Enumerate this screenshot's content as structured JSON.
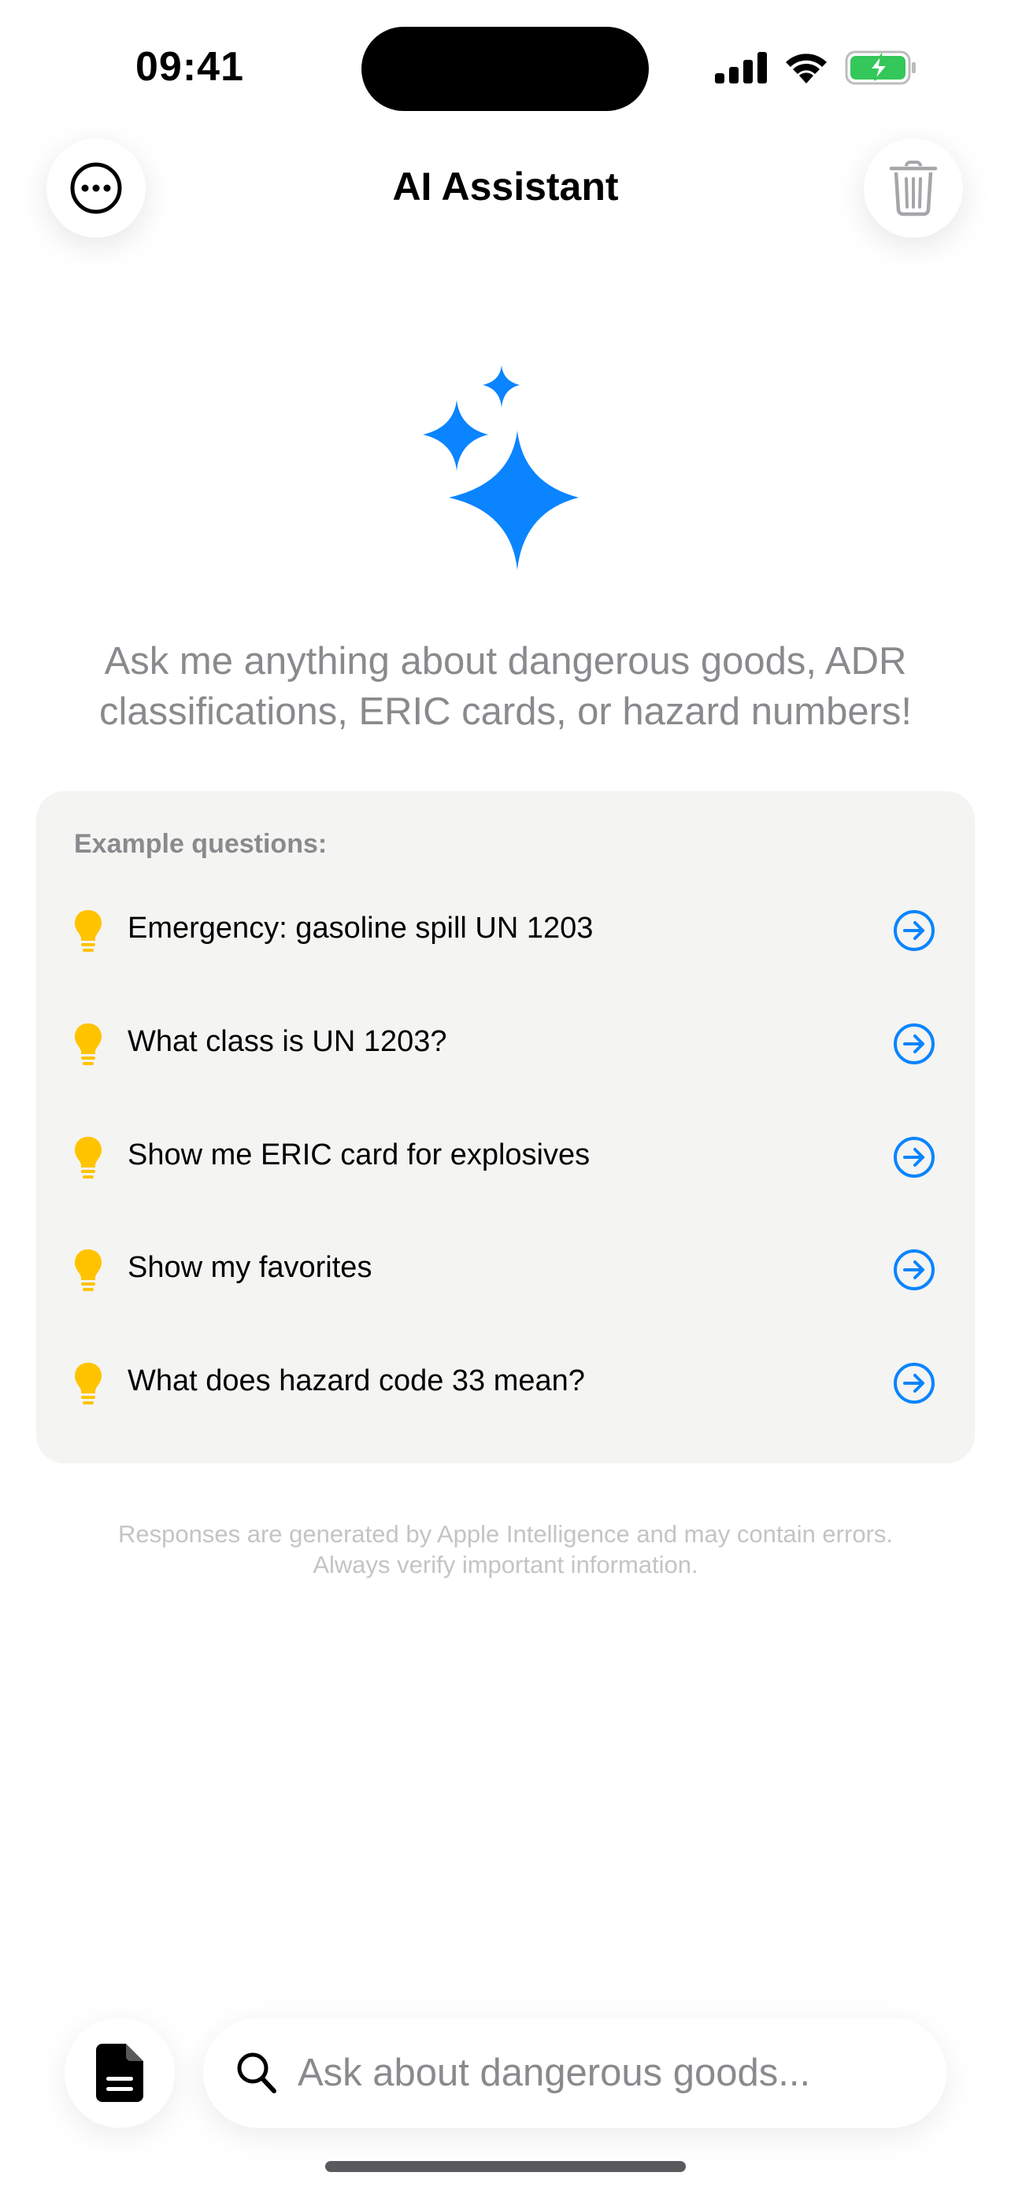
{
  "status_bar": {
    "time": "09:41"
  },
  "nav": {
    "title": "AI Assistant",
    "left_icon": "ellipsis-circle-icon",
    "right_icon": "trash-icon"
  },
  "hero": {
    "icon": "sparkles-icon",
    "intro": "Ask me anything about dangerous goods, ADR classifications, ERIC cards, or hazard numbers!"
  },
  "examples": {
    "heading": "Example questions:",
    "items": [
      {
        "label": "Emergency: gasoline spill UN 1203"
      },
      {
        "label": "What class is UN 1203?"
      },
      {
        "label": "Show me ERIC card for explosives"
      },
      {
        "label": "Show my favorites"
      },
      {
        "label": "What does hazard code 33 mean?"
      }
    ]
  },
  "disclaimer": {
    "line1": "Responses are generated by Apple Intelligence and may contain errors.",
    "line2": "Always verify important information."
  },
  "input": {
    "placeholder": "Ask about dangerous goods...",
    "value": ""
  },
  "colors": {
    "accent": "#0A84FF",
    "bulb": "#FFC300",
    "card_bg": "#F4F4F2",
    "muted_text": "#8A8A8E",
    "battery_green": "#34C759"
  }
}
